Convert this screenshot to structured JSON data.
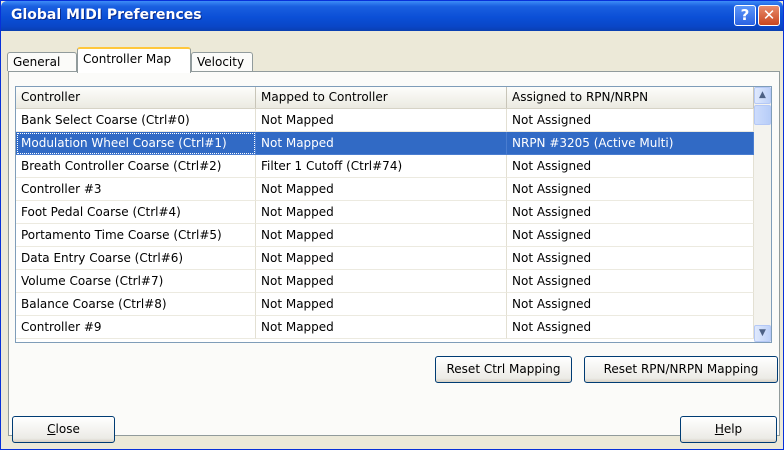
{
  "window": {
    "title": "Global MIDI Preferences",
    "help_glyph": "?",
    "close_glyph": "✕"
  },
  "tabs": [
    {
      "label": "General",
      "active": false
    },
    {
      "label": "Controller Map",
      "active": true
    },
    {
      "label": "Velocity",
      "active": false
    }
  ],
  "table": {
    "columns": [
      "Controller",
      "Mapped to Controller",
      "Assigned to RPN/NRPN"
    ],
    "selected_index": 1,
    "rows": [
      [
        "Bank Select Coarse (Ctrl#0)",
        "Not Mapped",
        "Not Assigned"
      ],
      [
        "Modulation Wheel Coarse (Ctrl#1)",
        "Not Mapped",
        "NRPN #3205 (Active Multi)"
      ],
      [
        "Breath Controller Coarse (Ctrl#2)",
        "Filter 1 Cutoff (Ctrl#74)",
        "Not Assigned"
      ],
      [
        "Controller #3",
        "Not Mapped",
        "Not Assigned"
      ],
      [
        "Foot Pedal Coarse (Ctrl#4)",
        "Not Mapped",
        "Not Assigned"
      ],
      [
        "Portamento Time Coarse (Ctrl#5)",
        "Not Mapped",
        "Not Assigned"
      ],
      [
        "Data Entry Coarse (Ctrl#6)",
        "Not Mapped",
        "Not Assigned"
      ],
      [
        "Volume Coarse (Ctrl#7)",
        "Not Mapped",
        "Not Assigned"
      ],
      [
        "Balance Coarse (Ctrl#8)",
        "Not Mapped",
        "Not Assigned"
      ],
      [
        "Controller #9",
        "Not Mapped",
        "Not Assigned"
      ]
    ]
  },
  "scrollbar": {
    "up_glyph": "▲",
    "down_glyph": "▼"
  },
  "buttons": {
    "reset_ctrl": "Reset Ctrl Mapping",
    "reset_rpn": "Reset RPN/NRPN Mapping",
    "close_accel": "C",
    "close_rest": "lose",
    "help_accel": "H",
    "help_rest": "elp"
  }
}
